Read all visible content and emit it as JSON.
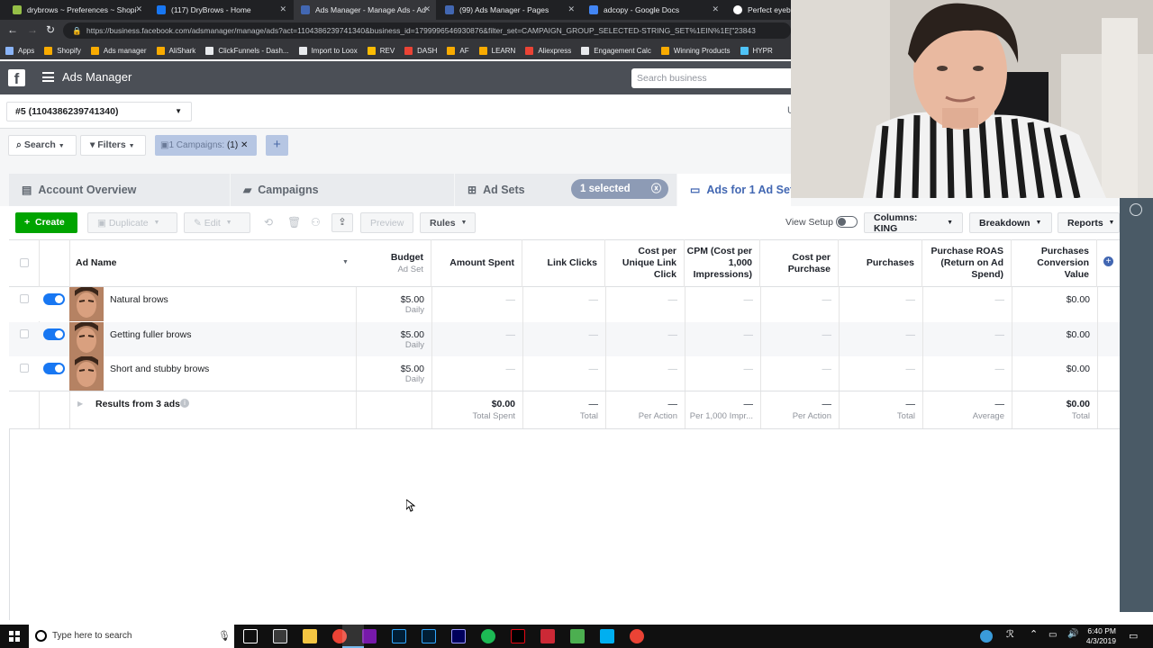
{
  "browser": {
    "tabs": [
      {
        "title": "drybrows ~ Preferences ~ Shopi",
        "color": "#95bf47"
      },
      {
        "title": "(117) DryBrows - Home",
        "color": "#1877f2"
      },
      {
        "title": "Ads Manager - Manage Ads - Ad",
        "color": "#4267b2"
      },
      {
        "title": "(99) Ads Manager - Pages",
        "color": "#4267b2"
      },
      {
        "title": "adcopy - Google Docs",
        "color": "#4285f4"
      },
      {
        "title": "Perfect eyebrov",
        "color": "#ffffff"
      }
    ],
    "url": "https://business.facebook.com/adsmanager/manage/ads?act=1104386239741340&business_id=1799996546930876&filter_set=CAMPAIGN_GROUP_SELECTED-STRING_SET%1EIN%1E[\"23843",
    "bookmarks": [
      {
        "label": "Apps",
        "color": "#8ab4f8"
      },
      {
        "label": "Shopify",
        "color": "#f9ab00"
      },
      {
        "label": "Ads manager",
        "color": "#f9ab00"
      },
      {
        "label": "AliShark",
        "color": "#f9ab00"
      },
      {
        "label": "ClickFunnels - Dash...",
        "color": "#e8eaed"
      },
      {
        "label": "Import to Loox",
        "color": "#e8eaed"
      },
      {
        "label": "REV",
        "color": "#fbbc04"
      },
      {
        "label": "DASH",
        "color": "#ea4335"
      },
      {
        "label": "AF",
        "color": "#f9ab00"
      },
      {
        "label": "LEARN",
        "color": "#f9ab00"
      },
      {
        "label": "Aliexpress",
        "color": "#ea4335"
      },
      {
        "label": "Engagement Calc",
        "color": "#e8eaed"
      },
      {
        "label": "Winning Products",
        "color": "#f9ab00"
      },
      {
        "label": "HYPR",
        "color": "#4fc3f7"
      }
    ]
  },
  "header": {
    "app_title": "Ads Manager",
    "search_placeholder": "Search business",
    "account": "#5 (1104386239741340)"
  },
  "filters": {
    "search": "Search",
    "filters": "Filters",
    "chip": "1 Campaigns:",
    "chip_count": "(1)"
  },
  "nav": {
    "overview": "Account Overview",
    "campaigns": "Campaigns",
    "adsets": "Ad Sets",
    "selected": "1 selected",
    "ads": "Ads for 1 Ad Set"
  },
  "toolbar": {
    "create": "Create",
    "duplicate": "Duplicate",
    "edit": "Edit",
    "preview": "Preview",
    "rules": "Rules",
    "view_setup": "View Setup",
    "columns": "Columns: KING",
    "breakdown": "Breakdown",
    "reports": "Reports"
  },
  "table": {
    "headers": {
      "ad_name": "Ad Name",
      "budget": "Budget",
      "budget_sub": "Ad Set",
      "amount_spent": "Amount Spent",
      "link_clicks": "Link Clicks",
      "cost_unique": "Cost per Unique Link Click",
      "cpm": "CPM (Cost per 1,000 Impressions)",
      "cost_purchase": "Cost per Purchase",
      "purchases": "Purchases",
      "roas": "Purchase ROAS (Return on Ad Spend)",
      "conv_value": "Purchases Conversion Value"
    },
    "rows": [
      {
        "name": "Natural brows",
        "budget": "$5.00",
        "period": "Daily",
        "dash": "—",
        "value": "$0.00",
        "active": true
      },
      {
        "name": "Getting fuller brows",
        "budget": "$5.00",
        "period": "Daily",
        "dash": "—",
        "value": "$0.00",
        "active": true
      },
      {
        "name": "Short and stubby brows",
        "budget": "$5.00",
        "period": "Daily",
        "dash": "—",
        "value": "$0.00",
        "active": true
      }
    ],
    "summary": {
      "label": "Results from 3 ads",
      "spent": "$0.00",
      "spent_sub": "Total Spent",
      "dash": "—",
      "total": "Total",
      "per_action": "Per Action",
      "per_1000": "Per 1,000 Impr...",
      "average": "Average",
      "value": "$0.00"
    }
  },
  "taskbar": {
    "search_placeholder": "Type here to search",
    "time": "6:40 PM",
    "date": "4/3/2019"
  }
}
